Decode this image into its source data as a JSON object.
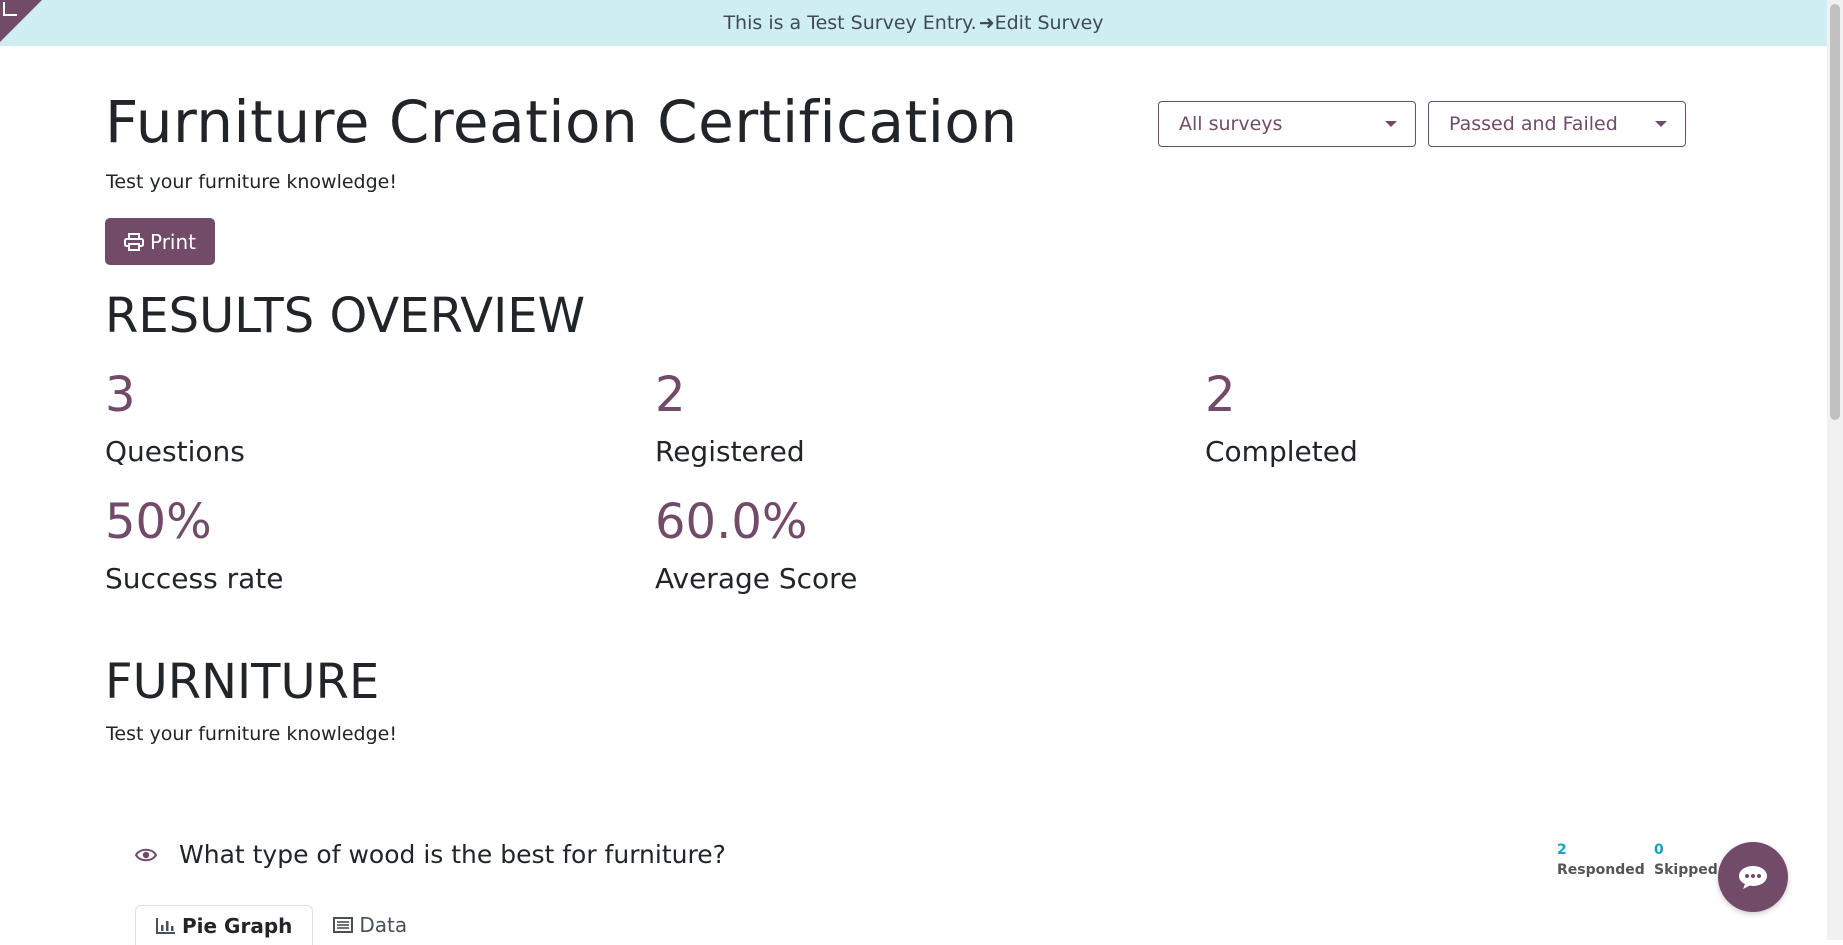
{
  "banner": {
    "text": "This is a Test Survey Entry.",
    "link_arrow": "➜",
    "link_label": "Edit Survey"
  },
  "survey": {
    "title": "Furniture Creation Certification",
    "description": "Test your furniture knowledge!"
  },
  "filters": {
    "survey_select": "All surveys",
    "result_select": "Passed and Failed"
  },
  "print_label": "Print",
  "overview": {
    "heading": "RESULTS OVERVIEW",
    "stats": [
      {
        "value": "3",
        "label": "Questions"
      },
      {
        "value": "2",
        "label": "Registered"
      },
      {
        "value": "2",
        "label": "Completed"
      },
      {
        "value": "50%",
        "label": "Success rate"
      },
      {
        "value": "60.0%",
        "label": "Average Score"
      }
    ]
  },
  "section": {
    "heading": "FURNITURE",
    "description": "Test your furniture knowledge!"
  },
  "question": {
    "text": "What type of wood is the best for furniture?",
    "responded_count": "2",
    "responded_label": "Responded",
    "skipped_count": "0",
    "skipped_label": "Skipped",
    "tabs": [
      {
        "label": "Pie Graph",
        "icon": "bar-chart-icon"
      },
      {
        "label": "Data",
        "icon": "list-icon"
      }
    ]
  },
  "colors": {
    "brand": "#714b67",
    "banner_bg": "#cfeef2",
    "count_accent": "#17a2b8"
  }
}
